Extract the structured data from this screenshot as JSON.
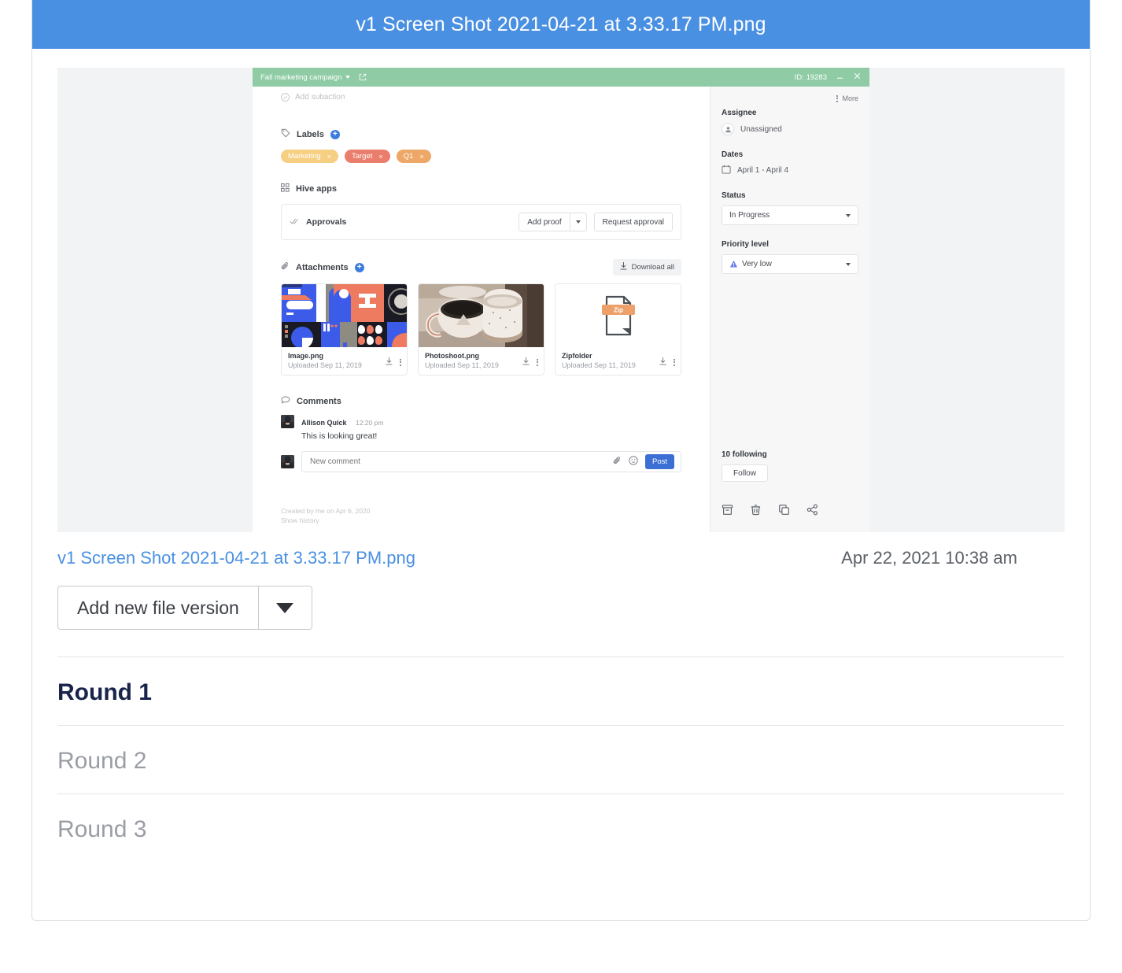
{
  "header": {
    "title": "v1 Screen Shot 2021-04-21 at 3.33.17 PM.png",
    "bg": "#4a90e2"
  },
  "preview": {
    "topbar": {
      "project": "Fall marketing campaign",
      "id_label": "ID: 19283",
      "open_icon": "external-link-icon",
      "minimize_icon": "minimize-icon",
      "close_icon": "close-icon",
      "bg": "#8fcca5"
    },
    "subaction": {
      "label": "Add subaction",
      "icon": "check-circle-icon"
    },
    "labels": {
      "heading": "Labels",
      "add_icon": "plus-circle-icon",
      "chips": [
        {
          "text": "Marketing",
          "color": "#f6cf82",
          "close": "×"
        },
        {
          "text": "Target",
          "color": "#ea7d6b",
          "close": "×"
        },
        {
          "text": "Q1",
          "color": "#eda767",
          "close": "×"
        }
      ]
    },
    "hive_apps": {
      "heading": "Hive apps",
      "icon": "grid-icon"
    },
    "approvals": {
      "label": "Approvals",
      "icon": "double-check-icon",
      "add_proof": "Add proof",
      "request_approval": "Request approval"
    },
    "attachments": {
      "heading": "Attachments",
      "add_icon": "plus-circle-icon",
      "download_all": "Download all",
      "items": [
        {
          "name": "Image.png",
          "uploaded": "Uploaded Sep 11, 2019",
          "kind": "art"
        },
        {
          "name": "Photoshoot.png",
          "uploaded": "Uploaded Sep 11, 2019",
          "kind": "photo"
        },
        {
          "name": "Zipfolder",
          "uploaded": "Uploaded Sep 11, 2019",
          "kind": "zip",
          "badge": "Zip"
        }
      ]
    },
    "comments": {
      "heading": "Comments",
      "icon": "comment-bubble-icon",
      "list": [
        {
          "author": "Allison Quick",
          "time": "12:20 pm",
          "text": "This is looking great!"
        }
      ],
      "new_comment_placeholder": "New comment",
      "post_label": "Post",
      "attach_icon": "paperclip-icon",
      "emoji_icon": "smiley-icon"
    },
    "footer": {
      "created": "Created by me on Apr 6, 2020",
      "history": "Show history"
    },
    "sidebar": {
      "more": "More",
      "assignee": {
        "label": "Assignee",
        "value": "Unassigned",
        "icon": "person-icon"
      },
      "dates": {
        "label": "Dates",
        "value": "April 1 - April 4",
        "icon": "calendar-icon"
      },
      "status": {
        "label": "Status",
        "value": "In Progress"
      },
      "priority": {
        "label": "Priority level",
        "value": "Very low",
        "icon": "triangle-priority-icon",
        "color": "#6a7fe8"
      },
      "following": {
        "count": "10 following",
        "button": "Follow"
      },
      "actions": [
        "archive-icon",
        "trash-icon",
        "duplicate-icon",
        "share-icon"
      ]
    }
  },
  "file": {
    "link": "v1 Screen Shot 2021-04-21 at 3.33.17 PM.png",
    "date": "Apr 22, 2021 10:38 am"
  },
  "version_button": {
    "label": "Add new file version",
    "dropdown_icon": "chevron-down-icon"
  },
  "rounds": [
    {
      "label": "Round 1",
      "active": true
    },
    {
      "label": "Round 2",
      "active": false
    },
    {
      "label": "Round 3",
      "active": false
    }
  ]
}
